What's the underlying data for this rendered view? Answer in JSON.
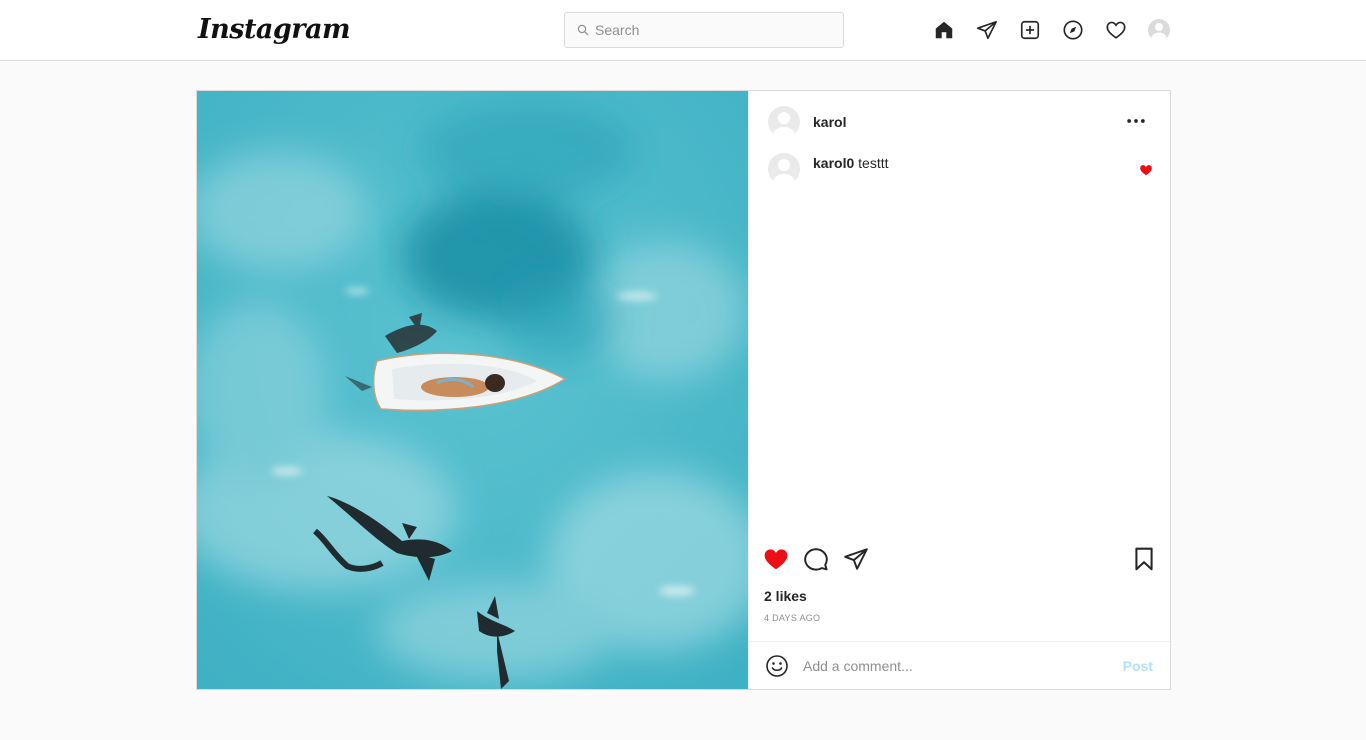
{
  "header": {
    "logo": "Instagram",
    "search": {
      "placeholder": "Search",
      "value": ""
    },
    "nav_icons": [
      "home-icon",
      "direct-icon",
      "new-post-icon",
      "explore-icon",
      "activity-icon",
      "profile-avatar"
    ]
  },
  "post": {
    "author": "karol",
    "caption": {
      "user": "karol0",
      "text": "testtt",
      "liked": true
    },
    "liked": true,
    "likes": "2 likes",
    "time_ago": "4 DAYS AGO",
    "image": {
      "description_icon": "photo",
      "colors": {
        "water": "#4fb8c8",
        "shark": "#1e2a2d"
      }
    }
  },
  "comment_box": {
    "placeholder": "Add a comment...",
    "post_label": "Post"
  },
  "colors": {
    "like_red": "#ed4956",
    "border": "#dbdbdb",
    "post_disabled": "#b2dffc"
  }
}
